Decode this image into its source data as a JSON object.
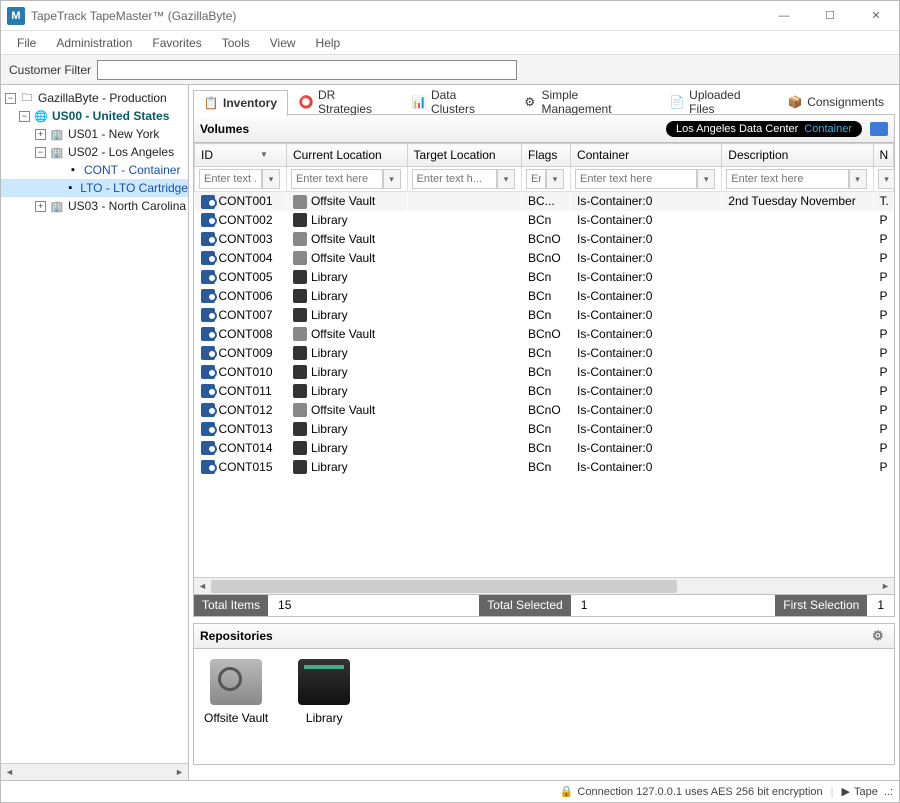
{
  "title": "TapeTrack TapeMaster™ (GazillaByte)",
  "menu": [
    "File",
    "Administration",
    "Favorites",
    "Tools",
    "View",
    "Help"
  ],
  "filter": {
    "label": "Customer Filter",
    "value": ""
  },
  "tree": {
    "root": "GazillaByte - Production",
    "us00": "US00 - United States",
    "us01": "US01 - New York",
    "us02": "US02 - Los Angeles",
    "cont": "CONT - Container",
    "lto": "LTO - LTO Cartridge",
    "us03": "US03 - North Carolina"
  },
  "tabs": [
    {
      "label": "Inventory"
    },
    {
      "label": "DR Strategies"
    },
    {
      "label": "Data Clusters"
    },
    {
      "label": "Simple Management"
    },
    {
      "label": "Uploaded Files"
    },
    {
      "label": "Consignments"
    }
  ],
  "volumes": {
    "title": "Volumes",
    "pill1": "Los Angeles Data Center",
    "pill2": "Container"
  },
  "columns": {
    "id": "ID",
    "loc": "Current Location",
    "tgt": "Target Location",
    "flg": "Flags",
    "cnt": "Container",
    "dsc": "Description",
    "n": "N"
  },
  "placeholders": {
    "std": "Enter text here",
    "id": "Enter text ...",
    "tgt": "Enter text h...",
    "flg": "En..."
  },
  "rows": [
    {
      "id": "CONT001",
      "loc": "Offsite Vault",
      "locType": "vault",
      "flg": "BC...",
      "cnt": "Is-Container:0",
      "dsc": "2nd Tuesday November",
      "n": "T."
    },
    {
      "id": "CONT002",
      "loc": "Library",
      "locType": "lib",
      "flg": "BCn",
      "cnt": "Is-Container:0",
      "dsc": "",
      "n": "P"
    },
    {
      "id": "CONT003",
      "loc": "Offsite Vault",
      "locType": "vault",
      "flg": "BCnO",
      "cnt": "Is-Container:0",
      "dsc": "",
      "n": "P"
    },
    {
      "id": "CONT004",
      "loc": "Offsite Vault",
      "locType": "vault",
      "flg": "BCnO",
      "cnt": "Is-Container:0",
      "dsc": "",
      "n": "P"
    },
    {
      "id": "CONT005",
      "loc": "Library",
      "locType": "lib",
      "flg": "BCn",
      "cnt": "Is-Container:0",
      "dsc": "",
      "n": "P"
    },
    {
      "id": "CONT006",
      "loc": "Library",
      "locType": "lib",
      "flg": "BCn",
      "cnt": "Is-Container:0",
      "dsc": "",
      "n": "P"
    },
    {
      "id": "CONT007",
      "loc": "Library",
      "locType": "lib",
      "flg": "BCn",
      "cnt": "Is-Container:0",
      "dsc": "",
      "n": "P"
    },
    {
      "id": "CONT008",
      "loc": "Offsite Vault",
      "locType": "vault",
      "flg": "BCnO",
      "cnt": "Is-Container:0",
      "dsc": "",
      "n": "P"
    },
    {
      "id": "CONT009",
      "loc": "Library",
      "locType": "lib",
      "flg": "BCn",
      "cnt": "Is-Container:0",
      "dsc": "",
      "n": "P"
    },
    {
      "id": "CONT010",
      "loc": "Library",
      "locType": "lib",
      "flg": "BCn",
      "cnt": "Is-Container:0",
      "dsc": "",
      "n": "P"
    },
    {
      "id": "CONT011",
      "loc": "Library",
      "locType": "lib",
      "flg": "BCn",
      "cnt": "Is-Container:0",
      "dsc": "",
      "n": "P"
    },
    {
      "id": "CONT012",
      "loc": "Offsite Vault",
      "locType": "vault",
      "flg": "BCnO",
      "cnt": "Is-Container:0",
      "dsc": "",
      "n": "P"
    },
    {
      "id": "CONT013",
      "loc": "Library",
      "locType": "lib",
      "flg": "BCn",
      "cnt": "Is-Container:0",
      "dsc": "",
      "n": "P"
    },
    {
      "id": "CONT014",
      "loc": "Library",
      "locType": "lib",
      "flg": "BCn",
      "cnt": "Is-Container:0",
      "dsc": "",
      "n": "P"
    },
    {
      "id": "CONT015",
      "loc": "Library",
      "locType": "lib",
      "flg": "BCn",
      "cnt": "Is-Container:0",
      "dsc": "",
      "n": "P"
    }
  ],
  "totals": {
    "items_label": "Total Items",
    "items": "15",
    "sel_label": "Total Selected",
    "sel": "1",
    "first_label": "First Selection",
    "first": "1"
  },
  "repos": {
    "title": "Repositories",
    "vault": "Offsite Vault",
    "lib": "Library"
  },
  "status": {
    "conn": "Connection 127.0.0.1 uses AES 256 bit encryption",
    "tape": "Tape"
  }
}
